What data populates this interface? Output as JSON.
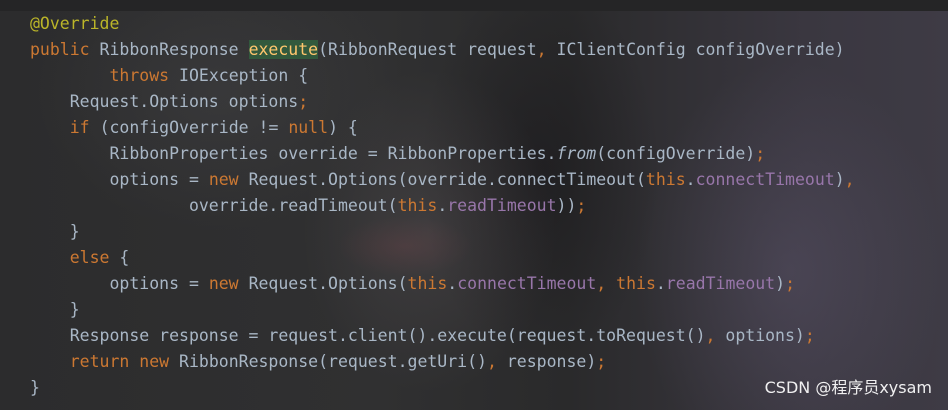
{
  "editor": {
    "language": "java",
    "lines": [
      {
        "t": [
          {
            "c": "ann",
            "v": "@Override"
          }
        ]
      },
      {
        "t": [
          {
            "c": "kw",
            "v": "public "
          },
          {
            "c": "",
            "v": "RibbonResponse "
          },
          {
            "c": "fn-def",
            "v": "execute"
          },
          {
            "c": "",
            "v": "(RibbonRequest request"
          },
          {
            "c": "punct",
            "v": ", "
          },
          {
            "c": "",
            "v": "IClientConfig configOverride)"
          }
        ]
      },
      {
        "t": [
          {
            "c": "",
            "v": "        "
          },
          {
            "c": "kw",
            "v": "throws "
          },
          {
            "c": "",
            "v": "IOException {"
          }
        ]
      },
      {
        "t": [
          {
            "c": "",
            "v": "    Request.Options options"
          },
          {
            "c": "punct",
            "v": ";"
          }
        ]
      },
      {
        "t": [
          {
            "c": "",
            "v": "    "
          },
          {
            "c": "kw",
            "v": "if "
          },
          {
            "c": "",
            "v": "(configOverride != "
          },
          {
            "c": "kw",
            "v": "null"
          },
          {
            "c": "",
            "v": ") {"
          }
        ]
      },
      {
        "t": [
          {
            "c": "",
            "v": "        RibbonProperties override = RibbonProperties."
          },
          {
            "c": "static",
            "v": "from"
          },
          {
            "c": "",
            "v": "(configOverride)"
          },
          {
            "c": "punct",
            "v": ";"
          }
        ]
      },
      {
        "t": [
          {
            "c": "",
            "v": "        options = "
          },
          {
            "c": "kw",
            "v": "new "
          },
          {
            "c": "",
            "v": "Request.Options(override.connectTimeout("
          },
          {
            "c": "kw",
            "v": "this"
          },
          {
            "c": "",
            "v": "."
          },
          {
            "c": "field",
            "v": "connectTimeout"
          },
          {
            "c": "",
            "v": ")"
          },
          {
            "c": "punct",
            "v": ","
          }
        ]
      },
      {
        "t": [
          {
            "c": "",
            "v": "                override.readTimeout("
          },
          {
            "c": "kw",
            "v": "this"
          },
          {
            "c": "",
            "v": "."
          },
          {
            "c": "field",
            "v": "readTimeout"
          },
          {
            "c": "",
            "v": "))"
          },
          {
            "c": "punct",
            "v": ";"
          }
        ]
      },
      {
        "t": [
          {
            "c": "",
            "v": "    }"
          }
        ]
      },
      {
        "t": [
          {
            "c": "",
            "v": "    "
          },
          {
            "c": "kw",
            "v": "else "
          },
          {
            "c": "",
            "v": "{"
          }
        ]
      },
      {
        "t": [
          {
            "c": "",
            "v": "        options = "
          },
          {
            "c": "kw",
            "v": "new "
          },
          {
            "c": "",
            "v": "Request.Options("
          },
          {
            "c": "kw",
            "v": "this"
          },
          {
            "c": "",
            "v": "."
          },
          {
            "c": "field",
            "v": "connectTimeout"
          },
          {
            "c": "punct",
            "v": ", "
          },
          {
            "c": "kw",
            "v": "this"
          },
          {
            "c": "",
            "v": "."
          },
          {
            "c": "field",
            "v": "readTimeout"
          },
          {
            "c": "",
            "v": ")"
          },
          {
            "c": "punct",
            "v": ";"
          }
        ]
      },
      {
        "t": [
          {
            "c": "",
            "v": "    }"
          }
        ]
      },
      {
        "t": [
          {
            "c": "",
            "v": "    Response response = request.client().execute(request.toRequest()"
          },
          {
            "c": "punct",
            "v": ", "
          },
          {
            "c": "",
            "v": "options)"
          },
          {
            "c": "punct",
            "v": ";"
          }
        ]
      },
      {
        "t": [
          {
            "c": "",
            "v": "    "
          },
          {
            "c": "kw",
            "v": "return new "
          },
          {
            "c": "",
            "v": "RibbonResponse(request.getUri()"
          },
          {
            "c": "punct",
            "v": ", "
          },
          {
            "c": "",
            "v": "response)"
          },
          {
            "c": "punct",
            "v": ";"
          }
        ]
      },
      {
        "t": [
          {
            "c": "",
            "v": "}"
          }
        ]
      }
    ]
  },
  "watermark": "CSDN @程序员xysam",
  "colors": {
    "background": "#2b2b2b",
    "default_text": "#a9b7c6",
    "keyword": "#cc7832",
    "annotation": "#bbb529",
    "method_declaration": "#ffc66d",
    "method_highlight_bg": "#32593d",
    "field": "#9876aa"
  }
}
